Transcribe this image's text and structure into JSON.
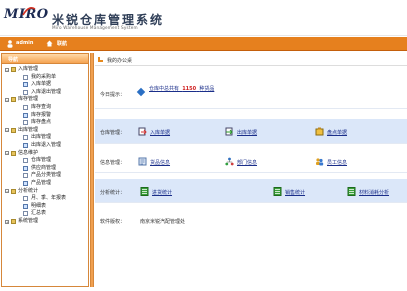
{
  "header": {
    "logo_text": "MIRO",
    "title": "米锐仓库管理系统",
    "subtitle": "Miro Warehouse Management System"
  },
  "topbar": {
    "user": "admin",
    "home": "联航"
  },
  "sidebar": {
    "tab_label": "导航",
    "tree": [
      {
        "label": "入库管理",
        "expanded": true,
        "children": [
          "我的采购单",
          "入库单据",
          "入库退出管理"
        ]
      },
      {
        "label": "库存管理",
        "expanded": true,
        "children": [
          "库存查询",
          "库存报警",
          "库存盘点"
        ]
      },
      {
        "label": "出库管理",
        "expanded": true,
        "children": [
          "出库管理",
          "出库退入管理"
        ]
      },
      {
        "label": "信息维护",
        "expanded": true,
        "children": [
          "仓库管理",
          "供应商管理",
          "产品分类管理",
          "产品管理"
        ]
      },
      {
        "label": "分析统计",
        "expanded": true,
        "children": [
          "月、季、年报表",
          "明细表",
          "汇总表"
        ]
      },
      {
        "label": "系统管理",
        "expanded": false,
        "children": []
      }
    ]
  },
  "main": {
    "breadcrumb": "我的办公桌",
    "notice": {
      "label": "今日提示：",
      "text_before": "仓库中总共有",
      "count": "1150",
      "text_after": "种货品"
    },
    "warehouse": {
      "label": "仓库管理：",
      "items": [
        "入库单据",
        "出库单据",
        "盘点单据"
      ]
    },
    "info": {
      "label": "信息管理：",
      "items": [
        "货品信息",
        "部门信息",
        "员工信息"
      ]
    },
    "analysis": {
      "label": "分析统计：",
      "items": [
        "进货统计",
        "销售统计",
        "材料消耗分析"
      ]
    },
    "copyright": {
      "label": "软件版权：",
      "value": "南京米锐汽配管理处"
    }
  },
  "colors": {
    "orange": "#e6801e",
    "blue_row": "#dbe7f9",
    "link": "#1a2e8a",
    "count_red": "#d02020"
  }
}
